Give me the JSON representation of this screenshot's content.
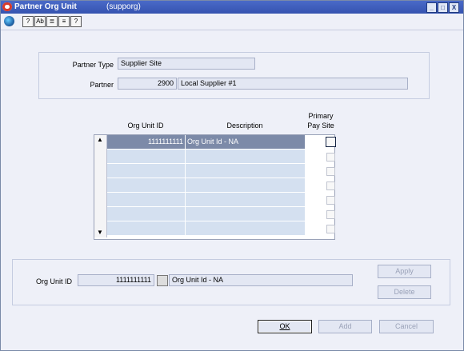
{
  "window": {
    "title": "Partner Org Unit",
    "subtitle": "(supporg)",
    "controls": [
      "_",
      "□",
      "X"
    ]
  },
  "toolbar": {
    "buttons": [
      "?",
      "Ab",
      "≣",
      "≡",
      "?"
    ]
  },
  "partner": {
    "type_label": "Partner Type",
    "type_value": "Supplier Site",
    "partner_label": "Partner",
    "partner_id": "2900",
    "partner_name": "Local Supplier #1"
  },
  "grid": {
    "headers": {
      "org_unit_id": "Org Unit ID",
      "description": "Description",
      "primary_pay_site": "Primary\nPay Site"
    },
    "rows": [
      {
        "org_unit_id": "1111111111",
        "description": "Org Unit Id - NA",
        "primary": false,
        "selected": true
      },
      {
        "org_unit_id": "",
        "description": "",
        "primary": false
      },
      {
        "org_unit_id": "",
        "description": "",
        "primary": false
      },
      {
        "org_unit_id": "",
        "description": "",
        "primary": false
      },
      {
        "org_unit_id": "",
        "description": "",
        "primary": false
      },
      {
        "org_unit_id": "",
        "description": "",
        "primary": false
      },
      {
        "org_unit_id": "",
        "description": "",
        "primary": false
      }
    ]
  },
  "detail": {
    "org_unit_label": "Org Unit ID",
    "org_unit_value": "1111111111",
    "org_unit_desc": "Org Unit Id - NA",
    "apply": "Apply",
    "delete": "Delete"
  },
  "footer": {
    "ok": "OK",
    "add": "Add",
    "cancel": "Cancel"
  }
}
